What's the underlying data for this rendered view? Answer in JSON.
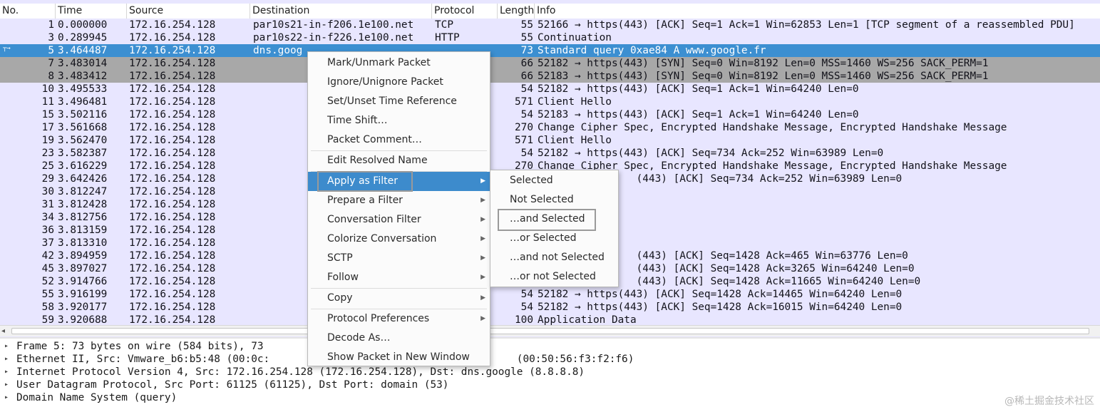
{
  "columns": {
    "no": "No.",
    "time": "Time",
    "source": "Source",
    "destination": "Destination",
    "protocol": "Protocol",
    "length": "Length",
    "info": "Info"
  },
  "packets": [
    {
      "no": "1",
      "time": "0.000000",
      "src": "172.16.254.128",
      "dst": "par10s21-in-f206.1e100.net",
      "proto": "TCP",
      "len": "55",
      "info": "52166 → https(443) [ACK] Seq=1 Ack=1 Win=62853 Len=1 [TCP segment of a reassembled PDU]"
    },
    {
      "no": "3",
      "time": "0.289945",
      "src": "172.16.254.128",
      "dst": "par10s22-in-f226.1e100.net",
      "proto": "HTTP",
      "len": "55",
      "info": "Continuation"
    },
    {
      "no": "5",
      "time": "3.464487",
      "src": "172.16.254.128",
      "dst": "dns.goog",
      "proto": "",
      "len": "73",
      "info": "Standard query 0xae84 A www.google.fr"
    },
    {
      "no": "7",
      "time": "3.483014",
      "src": "172.16.254.128",
      "dst": "",
      "proto": "",
      "len": "66",
      "info": "52182 → https(443) [SYN] Seq=0 Win=8192 Len=0 MSS=1460 WS=256 SACK_PERM=1"
    },
    {
      "no": "8",
      "time": "3.483412",
      "src": "172.16.254.128",
      "dst": "",
      "proto": "",
      "len": "66",
      "info": "52183 → https(443) [SYN] Seq=0 Win=8192 Len=0 MSS=1460 WS=256 SACK_PERM=1"
    },
    {
      "no": "10",
      "time": "3.495533",
      "src": "172.16.254.128",
      "dst": "",
      "proto": "",
      "len": "54",
      "info": "52182 → https(443) [ACK] Seq=1 Ack=1 Win=64240 Len=0"
    },
    {
      "no": "11",
      "time": "3.496481",
      "src": "172.16.254.128",
      "dst": "",
      "proto": "",
      "len": "571",
      "info": "Client Hello"
    },
    {
      "no": "15",
      "time": "3.502116",
      "src": "172.16.254.128",
      "dst": "",
      "proto": "",
      "len": "54",
      "info": "52183 → https(443) [ACK] Seq=1 Ack=1 Win=64240 Len=0"
    },
    {
      "no": "17",
      "time": "3.561668",
      "src": "172.16.254.128",
      "dst": "",
      "proto": "",
      "len": "270",
      "info": "Change Cipher Spec, Encrypted Handshake Message, Encrypted Handshake Message"
    },
    {
      "no": "19",
      "time": "3.562470",
      "src": "172.16.254.128",
      "dst": "",
      "proto": "",
      "len": "571",
      "info": "Client Hello"
    },
    {
      "no": "23",
      "time": "3.582387",
      "src": "172.16.254.128",
      "dst": "",
      "proto": "",
      "len": "54",
      "info": "52182 → https(443) [ACK] Seq=734 Ack=252 Win=63989 Len=0"
    },
    {
      "no": "25",
      "time": "3.616229",
      "src": "172.16.254.128",
      "dst": "",
      "proto": "",
      "len": "270",
      "info": "Change Cipher Spec, Encrypted Handshake Message, Encrypted Handshake Message"
    },
    {
      "no": "29",
      "time": "3.642426",
      "src": "172.16.254.128",
      "dst": "",
      "proto": "",
      "len": "",
      "info": "                (443) [ACK] Seq=734 Ack=252 Win=63989 Len=0"
    },
    {
      "no": "30",
      "time": "3.812247",
      "src": "172.16.254.128",
      "dst": "",
      "proto": "",
      "len": "",
      "info": ""
    },
    {
      "no": "31",
      "time": "3.812428",
      "src": "172.16.254.128",
      "dst": "",
      "proto": "",
      "len": "",
      "info": ""
    },
    {
      "no": "34",
      "time": "3.812756",
      "src": "172.16.254.128",
      "dst": "",
      "proto": "",
      "len": "",
      "info": ""
    },
    {
      "no": "36",
      "time": "3.813159",
      "src": "172.16.254.128",
      "dst": "",
      "proto": "",
      "len": "",
      "info": ""
    },
    {
      "no": "37",
      "time": "3.813310",
      "src": "172.16.254.128",
      "dst": "",
      "proto": "",
      "len": "",
      "info": ""
    },
    {
      "no": "42",
      "time": "3.894959",
      "src": "172.16.254.128",
      "dst": "",
      "proto": "",
      "len": "",
      "info": "                (443) [ACK] Seq=1428 Ack=465 Win=63776 Len=0"
    },
    {
      "no": "45",
      "time": "3.897027",
      "src": "172.16.254.128",
      "dst": "",
      "proto": "",
      "len": "",
      "info": "                (443) [ACK] Seq=1428 Ack=3265 Win=64240 Len=0"
    },
    {
      "no": "52",
      "time": "3.914766",
      "src": "172.16.254.128",
      "dst": "",
      "proto": "",
      "len": "",
      "info": "                (443) [ACK] Seq=1428 Ack=11665 Win=64240 Len=0"
    },
    {
      "no": "55",
      "time": "3.916199",
      "src": "172.16.254.128",
      "dst": "",
      "proto": "",
      "len": "54",
      "info": "52182 → https(443) [ACK] Seq=1428 Ack=14465 Win=64240 Len=0"
    },
    {
      "no": "58",
      "time": "3.920177",
      "src": "172.16.254.128",
      "dst": "",
      "proto": "",
      "len": "54",
      "info": "52182 → https(443) [ACK] Seq=1428 Ack=16015 Win=64240 Len=0"
    },
    {
      "no": "59",
      "time": "3.920688",
      "src": "172.16.254.128",
      "dst": "",
      "proto": "",
      "len": "100",
      "info": "Application Data"
    }
  ],
  "selected_row": "5",
  "marked_rows": [
    "7",
    "8"
  ],
  "details": [
    {
      "text": "Frame 5: 73 bytes on wire (584 bits), 73"
    },
    {
      "text": "Ethernet II, Src: Vmware_b6:b5:48 (00:0c:                                        (00:50:56:f3:f2:f6)"
    },
    {
      "text": "Internet Protocol Version 4, Src: 172.16.254.128 (172.16.254.128), Dst: dns.google (8.8.8.8)"
    },
    {
      "text": "User Datagram Protocol, Src Port: 61125 (61125), Dst Port: domain (53)"
    },
    {
      "text": "Domain Name System (query)"
    }
  ],
  "context_menu": [
    {
      "label": "Mark/Unmark Packet",
      "mnemonic": "M",
      "submenu": false
    },
    {
      "label": "Ignore/Unignore Packet",
      "mnemonic": "I",
      "submenu": false
    },
    {
      "label": "Set/Unset Time Reference",
      "mnemonic": "",
      "submenu": false
    },
    {
      "label": "Time Shift…",
      "mnemonic": "",
      "submenu": false
    },
    {
      "label": "Packet Comment…",
      "mnemonic": "",
      "submenu": false,
      "sep_after": true
    },
    {
      "label": "Edit Resolved Name",
      "mnemonic": "",
      "submenu": false,
      "sep_after": true
    },
    {
      "label": "Apply as Filter",
      "mnemonic": "",
      "submenu": true,
      "highlighted": true
    },
    {
      "label": "Prepare a Filter",
      "mnemonic": "",
      "submenu": true
    },
    {
      "label": "Conversation Filter",
      "mnemonic": "",
      "submenu": true
    },
    {
      "label": "Colorize Conversation",
      "mnemonic": "",
      "submenu": true
    },
    {
      "label": "SCTP",
      "mnemonic": "",
      "submenu": true
    },
    {
      "label": "Follow",
      "mnemonic": "",
      "submenu": true,
      "sep_after": true
    },
    {
      "label": "Copy",
      "mnemonic": "",
      "submenu": true,
      "sep_after": true
    },
    {
      "label": "Protocol Preferences",
      "mnemonic": "",
      "submenu": true
    },
    {
      "label": "Decode As…",
      "mnemonic": "",
      "submenu": false
    },
    {
      "label": "Show Packet in New Window",
      "mnemonic": "",
      "submenu": false
    }
  ],
  "submenu": [
    {
      "label": "Selected"
    },
    {
      "label": "Not Selected"
    },
    {
      "label": "…and Selected",
      "focused": true
    },
    {
      "label": "…or Selected"
    },
    {
      "label": "…and not Selected"
    },
    {
      "label": "…or not Selected"
    }
  ],
  "watermark": "@稀土掘金技术社区",
  "icons": {
    "related_packet": "related-arrow-icon",
    "submenu": "submenu-arrow-icon",
    "expand": "expand-arrow-icon"
  },
  "colors": {
    "row_bg": "#e8e6ff",
    "selected": "#3c8fd1",
    "marked": "#a8a8a8",
    "menu_highlight": "#3d8bcc"
  }
}
